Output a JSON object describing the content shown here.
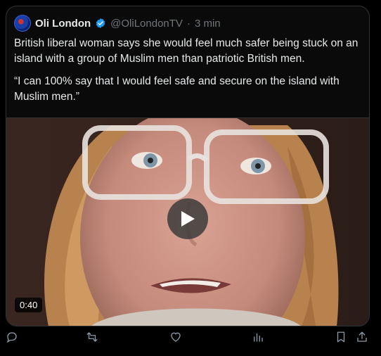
{
  "tweet": {
    "author_name": "Oli London",
    "handle": "@OliLondonTV",
    "separator": "·",
    "time": "3 min",
    "text_paragraph_1": "British liberal woman says she would feel much safer being stuck on an island with a group of Muslim men than patriotic British men.",
    "text_paragraph_2": "“I can 100% say that I would feel safe and secure on the island with Muslim men.”"
  },
  "media": {
    "duration": "0:40"
  },
  "icons": {
    "verified": "verified-badge-icon",
    "play": "play-icon",
    "reply": "reply-icon",
    "retweet": "retweet-icon",
    "like": "like-icon",
    "views": "views-icon",
    "bookmark": "bookmark-icon",
    "share": "share-icon"
  },
  "colors": {
    "background": "#000000",
    "text": "#e7e9ea",
    "muted": "#71767b",
    "verified": "#1d9bf0",
    "border": "#2f3336"
  }
}
